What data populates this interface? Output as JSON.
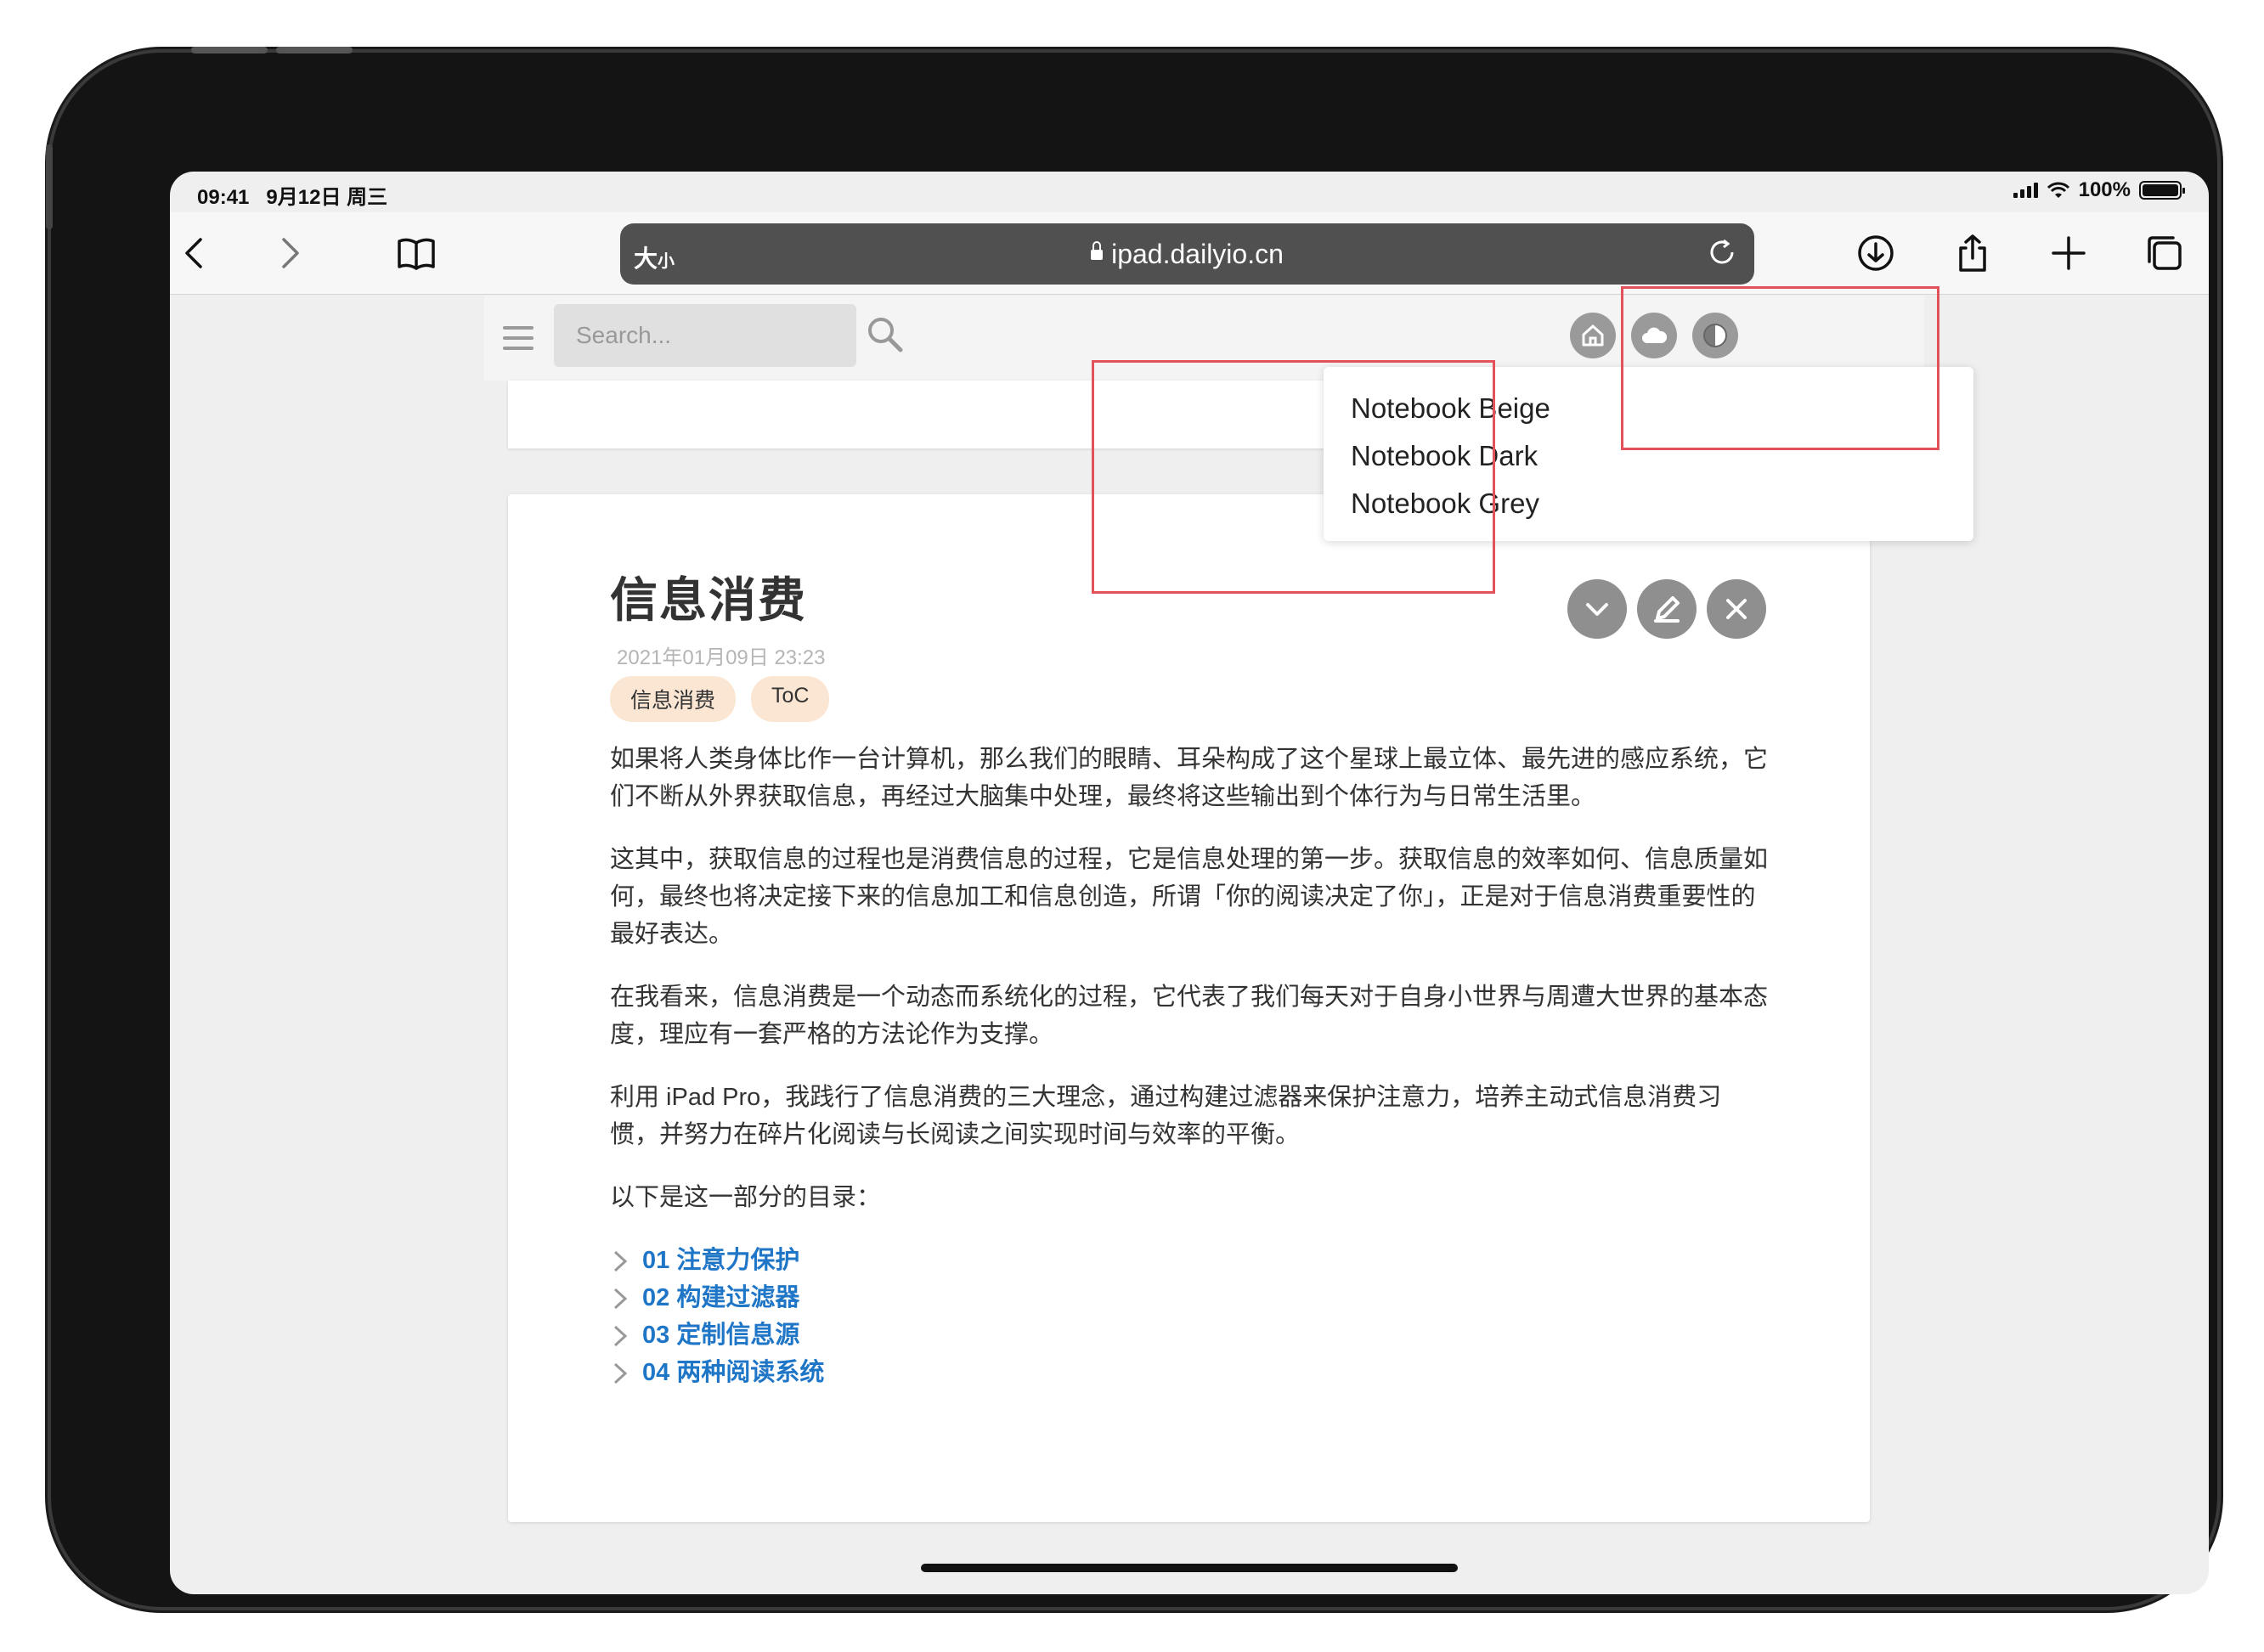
{
  "status_bar": {
    "time": "09:41",
    "date": "9月12日 周三",
    "battery": "100%",
    "battery_level": 1.0
  },
  "toolbar": {
    "back_icon": "chevron-left-icon",
    "forward_icon": "chevron-right-icon",
    "bookmarks_icon": "book-icon",
    "reader_label": "大",
    "reader_label_small": "小",
    "url": "ipad.dailyio.cn",
    "download_icon": "download-icon",
    "share_icon": "share-icon",
    "new_tab_icon": "plus-icon",
    "tabs_icon": "tabs-icon"
  },
  "site_header": {
    "search_placeholder": "Search...",
    "menu_icon": "hamburger-icon",
    "search_icon": "search-icon",
    "home_icon": "home-icon",
    "cloud_icon": "cloud-icon",
    "theme_icon": "contrast-icon"
  },
  "theme_menu": {
    "options": [
      "Notebook Beige",
      "Notebook Dark",
      "Notebook Grey"
    ]
  },
  "article": {
    "title": "信息消费",
    "date": "2021年01月09日 23:23",
    "tags": [
      "信息消费",
      "ToC"
    ],
    "paragraphs": [
      "如果将人类身体比作一台计算机，那么我们的眼睛、耳朵构成了这个星球上最立体、最先进的感应系统，它们不断从外界获取信息，再经过大脑集中处理，最终将这些输出到个体行为与日常生活里。",
      "这其中，获取信息的过程也是消费信息的过程，它是信息处理的第一步。获取信息的效率如何、信息质量如何，最终也将决定接下来的信息加工和信息创造，所谓「你的阅读决定了你」，正是对于信息消费重要性的最好表达。",
      "在我看来，信息消费是一个动态而系统化的过程，它代表了我们每天对于自身小世界与周遭大世界的基本态度，理应有一套严格的方法论作为支撑。",
      "利用 iPad Pro，我践行了信息消费的三大理念，通过构建过滤器来保护注意力，培养主动式信息消费习惯，并努力在碎片化阅读与长阅读之间实现时间与效率的平衡。",
      "以下是这一部分的目录："
    ],
    "toc": [
      "01 注意力保护",
      "02 构建过滤器",
      "03 定制信息源",
      "04 两种阅读系统"
    ],
    "controls": [
      "chevron-down-icon",
      "pencil-icon",
      "close-icon"
    ]
  },
  "colors": {
    "link": "#1f76c7",
    "tag_bg": "#fbe6d4",
    "highlight": "#e5515b",
    "address_bar": "#505050"
  }
}
